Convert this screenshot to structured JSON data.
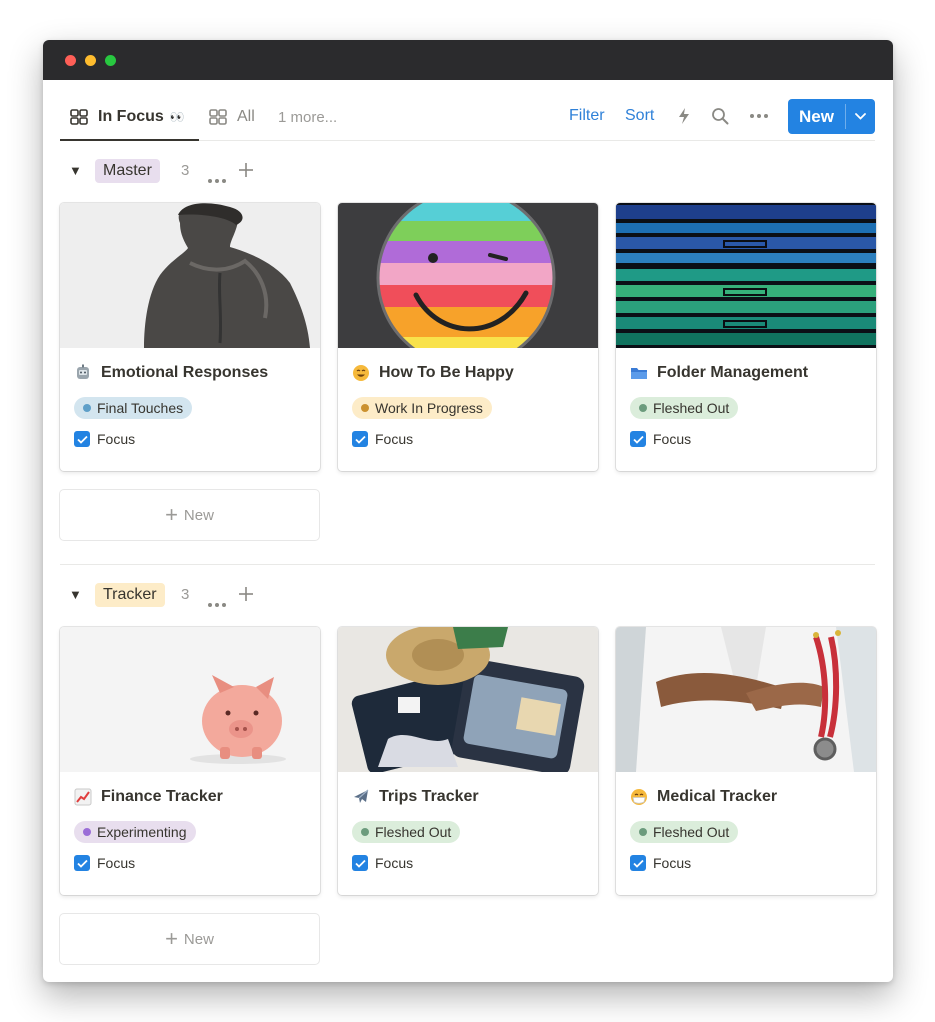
{
  "toolbar": {
    "tabs": [
      {
        "label": "In Focus",
        "suffix": "👀",
        "active": true
      },
      {
        "label": "All",
        "active": false
      }
    ],
    "more_views": "1 more...",
    "filter": "Filter",
    "sort": "Sort",
    "new_button": "New",
    "icons": [
      "lightning-icon",
      "search-icon",
      "more-icon",
      "chevron-down-icon"
    ]
  },
  "groups": [
    {
      "name": "Master",
      "count": "3",
      "tag_bg": "#e8deee",
      "new_label": "New",
      "cards": [
        {
          "title": "Emotional Responses",
          "emoji": "robot",
          "status": "Final Touches",
          "status_bg": "#d3e5ef",
          "status_dot": "#5e9fc8",
          "focus_label": "Focus",
          "focus": true,
          "cover": "statue"
        },
        {
          "title": "How To Be Happy",
          "emoji": "smiley",
          "status": "Work In Progress",
          "status_bg": "#fdecc8",
          "status_dot": "#cb912f",
          "focus_label": "Focus",
          "focus": true,
          "cover": "rainbow-smiley"
        },
        {
          "title": "Folder Management",
          "emoji": "folder",
          "status": "Fleshed Out",
          "status_bg": "#dbeddb",
          "status_dot": "#6c9b7d",
          "focus_label": "Focus",
          "focus": true,
          "cover": "folders"
        }
      ]
    },
    {
      "name": "Tracker",
      "count": "3",
      "tag_bg": "#fdecc8",
      "new_label": "New",
      "cards": [
        {
          "title": "Finance Tracker",
          "emoji": "chart",
          "status": "Experimenting",
          "status_bg": "#e8deee",
          "status_dot": "#9a6dd7",
          "focus_label": "Focus",
          "focus": true,
          "cover": "piggy-bank"
        },
        {
          "title": "Trips Tracker",
          "emoji": "plane",
          "status": "Fleshed Out",
          "status_bg": "#dbeddb",
          "status_dot": "#6c9b7d",
          "focus_label": "Focus",
          "focus": true,
          "cover": "luggage"
        },
        {
          "title": "Medical Tracker",
          "emoji": "mask",
          "status": "Fleshed Out",
          "status_bg": "#dbeddb",
          "status_dot": "#6c9b7d",
          "focus_label": "Focus",
          "focus": true,
          "cover": "doctor"
        }
      ]
    }
  ]
}
